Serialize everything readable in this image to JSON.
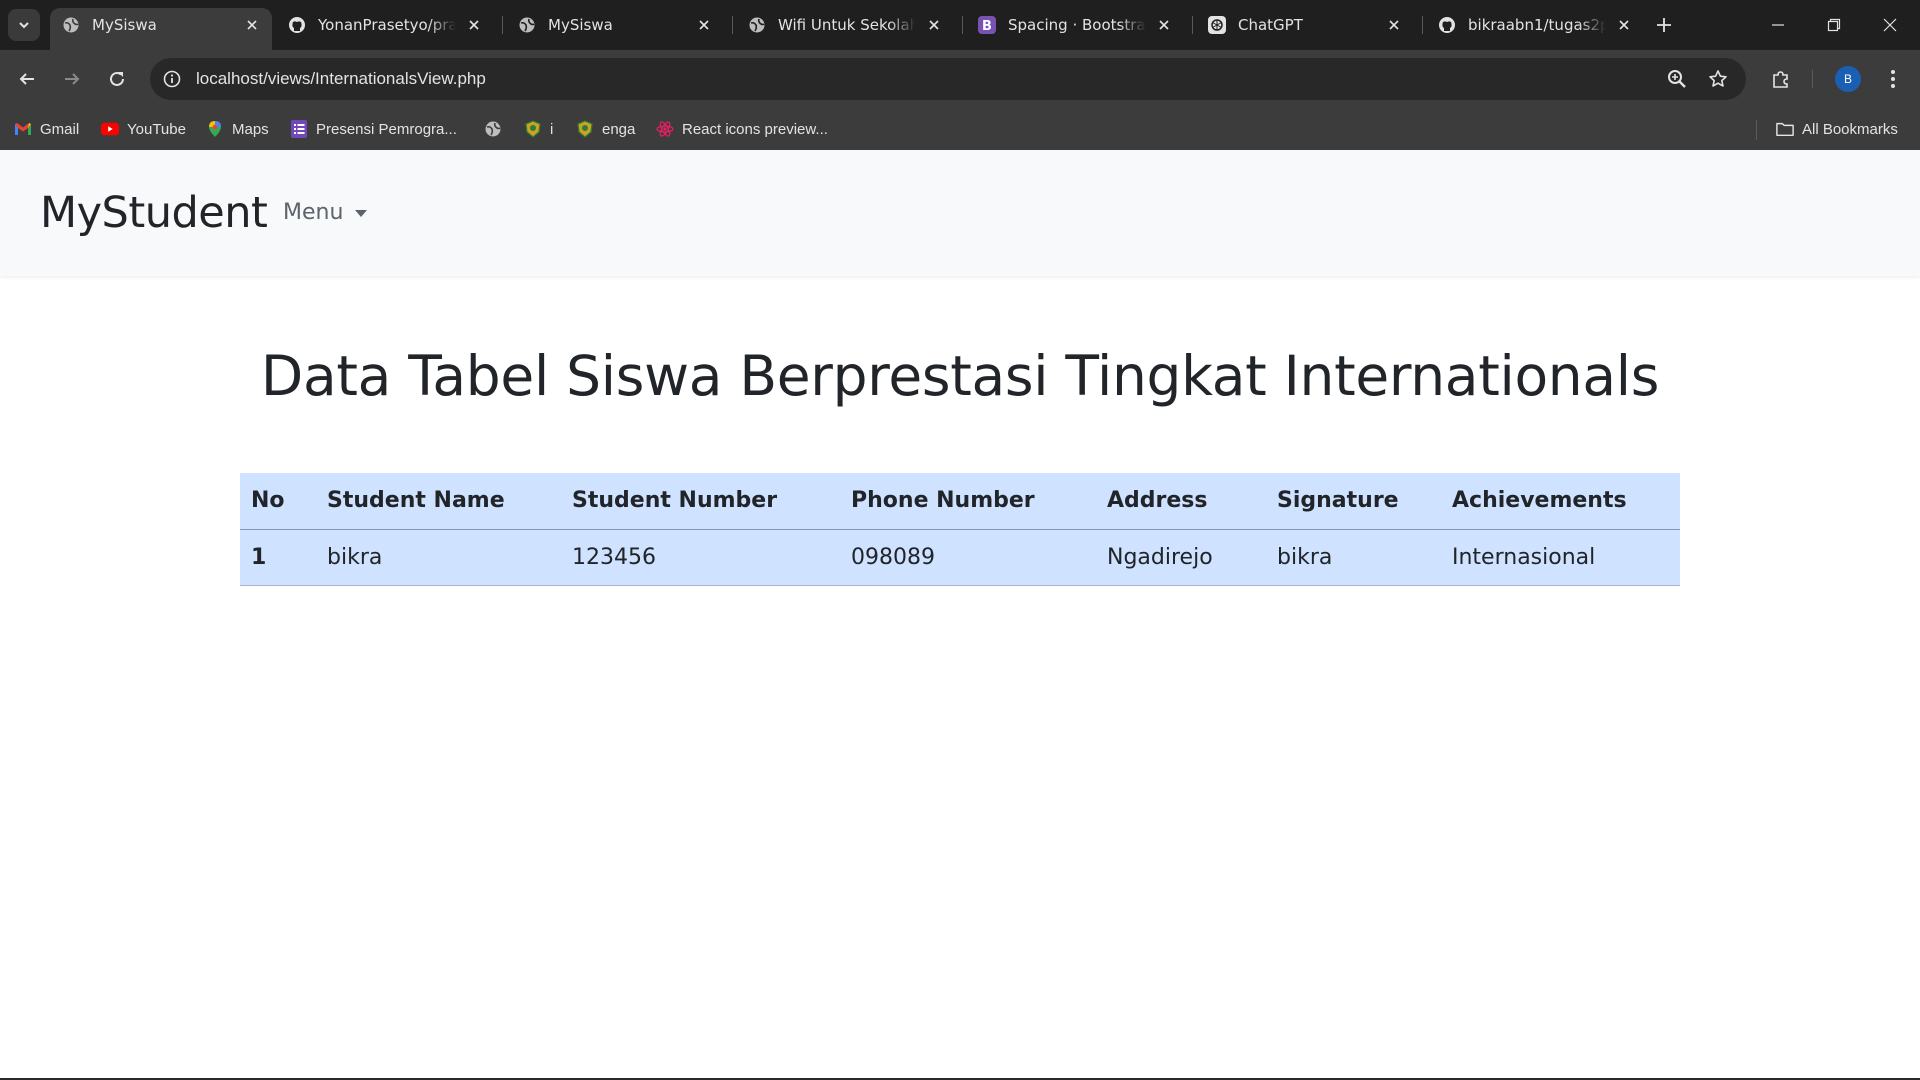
{
  "browser": {
    "tabs": [
      {
        "title": "MySiswa",
        "icon": "globe-icon",
        "active": true
      },
      {
        "title": "YonanPrasetyo/prakt",
        "icon": "github-icon",
        "active": false
      },
      {
        "title": "MySiswa",
        "icon": "globe-icon",
        "active": false
      },
      {
        "title": "Wifi Untuk Sekolah C",
        "icon": "globe-icon",
        "active": false
      },
      {
        "title": "Spacing · Bootstrap v",
        "icon": "bootstrap-icon",
        "active": false
      },
      {
        "title": "ChatGPT",
        "icon": "chatgpt-icon",
        "active": false
      },
      {
        "title": "bikraabn1/tugas2pw",
        "icon": "github-icon",
        "active": false
      }
    ],
    "address_bar": {
      "url": "localhost/views/InternationalsView.php"
    },
    "profile_initial": "B",
    "bookmarks": [
      {
        "label": "Gmail",
        "icon": "gmail-icon"
      },
      {
        "label": "YouTube",
        "icon": "youtube-icon"
      },
      {
        "label": "Maps",
        "icon": "maps-icon"
      },
      {
        "label": "Presensi Pemrogra...",
        "icon": "forms-icon"
      },
      {
        "label": "",
        "icon": "globe-icon"
      },
      {
        "label": "i",
        "icon": "crest-icon"
      },
      {
        "label": "enga",
        "icon": "crest-icon"
      },
      {
        "label": "React icons preview...",
        "icon": "react-icon"
      }
    ],
    "all_bookmarks_label": "All Bookmarks"
  },
  "navbar": {
    "brand": "MyStudent",
    "menu_label": "Menu"
  },
  "page": {
    "title": "Data Tabel Siswa Berprestasi Tingkat Internationals"
  },
  "table": {
    "header_color": "#cfe2ff",
    "columns": [
      "No",
      "Student Name",
      "Student Number",
      "Phone Number",
      "Address",
      "Signature",
      "Achievements"
    ],
    "rows": [
      [
        "1",
        "bikra",
        "123456",
        "098089",
        "Ngadirejo",
        "bikra",
        "Internasional"
      ]
    ]
  }
}
